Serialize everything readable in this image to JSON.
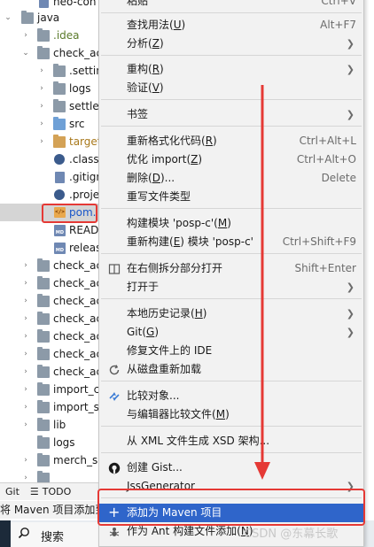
{
  "tree": {
    "rows": [
      {
        "label": "neo-con",
        "type": "file"
      },
      {
        "label": "java",
        "type": "folder"
      },
      {
        "label": ".idea",
        "type": "folder"
      },
      {
        "label": "check_ac",
        "type": "folder"
      },
      {
        "label": ".settin",
        "type": "folder"
      },
      {
        "label": "logs",
        "type": "folder"
      },
      {
        "label": "settle_",
        "type": "folder"
      },
      {
        "label": "src",
        "type": "folder"
      },
      {
        "label": "target",
        "type": "folder"
      },
      {
        "label": ".class",
        "type": "file"
      },
      {
        "label": ".gitign",
        "type": "file"
      },
      {
        "label": ".proje",
        "type": "file"
      },
      {
        "label": "pom.",
        "type": "xml"
      },
      {
        "label": "READ",
        "type": "md"
      },
      {
        "label": "releas",
        "type": "md"
      },
      {
        "label": "check_ac",
        "type": "folder"
      },
      {
        "label": "check_ac",
        "type": "folder"
      },
      {
        "label": "check_ac",
        "type": "folder"
      },
      {
        "label": "check_ac",
        "type": "folder"
      },
      {
        "label": "check_ac",
        "type": "folder"
      },
      {
        "label": "check_ac",
        "type": "folder"
      },
      {
        "label": "check_ac",
        "type": "folder"
      },
      {
        "label": "import_c",
        "type": "folder"
      },
      {
        "label": "import_s",
        "type": "folder"
      },
      {
        "label": "lib",
        "type": "folder"
      },
      {
        "label": "logs",
        "type": "folder"
      },
      {
        "label": "merch_se",
        "type": "folder"
      }
    ]
  },
  "bottom_tabs": {
    "git": "Git",
    "todo": "TODO"
  },
  "status_text": "将 Maven 项目添加到",
  "taskbar": {
    "search_label": "搜索"
  },
  "menu": {
    "top_partial": {
      "label": "粘贴",
      "shortcut": "Ctrl+V"
    },
    "find_usages": {
      "label": "查找用法",
      "mnemonic": "U",
      "shortcut": "Alt+F7"
    },
    "analyze": {
      "label": "分析",
      "mnemonic": "Z"
    },
    "refactor": {
      "label": "重构",
      "mnemonic": "R"
    },
    "validate": {
      "label": "验证",
      "mnemonic": "V"
    },
    "bookmarks": {
      "label": "书签"
    },
    "reformat": {
      "label": "重新格式化代码",
      "mnemonic": "R",
      "shortcut": "Ctrl+Alt+L"
    },
    "optimize_imports": {
      "label": "优化 import",
      "mnemonic": "Z",
      "shortcut": "Ctrl+Alt+O"
    },
    "delete": {
      "label": "删除",
      "mnemonic": "D",
      "suffix": "...",
      "shortcut": "Delete"
    },
    "override_file_type": {
      "label": "重写文件类型"
    },
    "build_module": {
      "label": "构建模块 'posp-c'",
      "mnemonic": "M"
    },
    "rebuild_module": {
      "label_a": "重新构建",
      "mnemonic": "E",
      "label_b": " 模块 'posp-c'",
      "shortcut": "Ctrl+Shift+F9"
    },
    "open_right_split": {
      "label": "在右侧拆分部分打开",
      "shortcut": "Shift+Enter"
    },
    "open_in": {
      "label": "打开于"
    },
    "local_history": {
      "label": "本地历史记录",
      "mnemonic": "H"
    },
    "git": {
      "label": "Git",
      "mnemonic": "G"
    },
    "repair_ide": {
      "label": "修复文件上的 IDE"
    },
    "reload_from_disk": {
      "label": "从磁盘重新加载"
    },
    "compare_with": {
      "label": "比较对象..."
    },
    "compare_with_editor": {
      "label": "与编辑器比较文件",
      "mnemonic": "M"
    },
    "generate_xsd": {
      "label": "从 XML 文件生成 XSD 架构..."
    },
    "create_gist": {
      "label": "创建 Gist..."
    },
    "jsgenerator": {
      "label": "JssGenerator"
    },
    "add_as_maven": {
      "label": "添加为 Maven 项目"
    },
    "add_as_ant": {
      "label": "作为 Ant 构建文件添加",
      "mnemonic": "N"
    }
  },
  "watermark": "CSDN @东幕长歌",
  "colors": {
    "menu_bg": "#f2f2f2",
    "active_bg": "#2f65ca",
    "annotation_red": "#e53935"
  }
}
